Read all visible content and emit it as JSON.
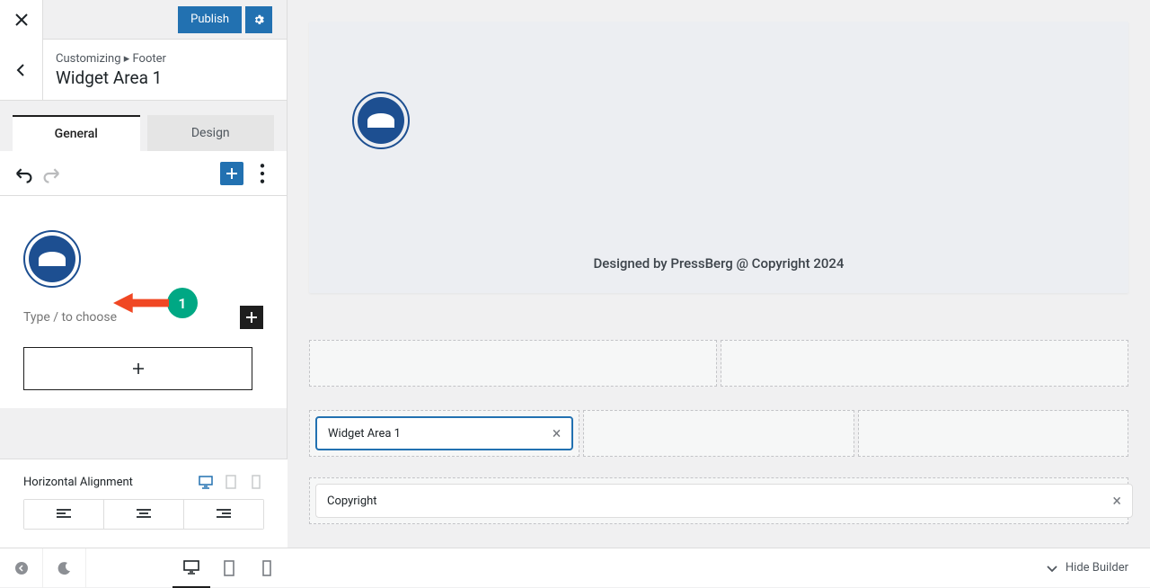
{
  "topbar": {
    "publish_label": "Publish"
  },
  "breadcrumb": {
    "path": "Customizing ▸ Footer",
    "title": "Widget Area 1"
  },
  "tabs": {
    "general": "General",
    "design": "Design"
  },
  "editor": {
    "type_placeholder": "Type / to choose"
  },
  "annotation": {
    "badge": "1"
  },
  "alignment": {
    "label": "Horizontal Alignment"
  },
  "preview": {
    "footer_text": "Designed by PressBerg @ Copyright 2024"
  },
  "builder": {
    "widget_area_1": "Widget Area 1",
    "copyright": "Copyright"
  },
  "bottom": {
    "hide_builder": "Hide Builder"
  }
}
